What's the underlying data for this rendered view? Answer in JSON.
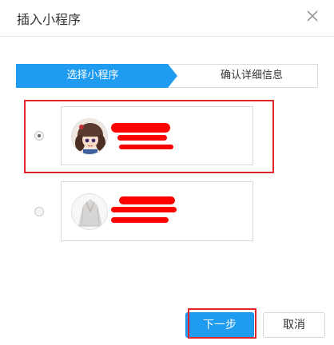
{
  "dialog": {
    "title": "插入小程序",
    "close_icon": "close-icon"
  },
  "steps": [
    {
      "label": "选择小程序",
      "active": true
    },
    {
      "label": "确认详细信息",
      "active": false
    }
  ],
  "options": [
    {
      "selected": true,
      "avatar_icon": "anime-girl-avatar"
    },
    {
      "selected": false,
      "avatar_icon": "grey-cloak-avatar"
    }
  ],
  "footer": {
    "next_label": "下一步",
    "cancel_label": "取消"
  },
  "colors": {
    "accent": "#1f9bf0",
    "highlight": "#e0242b",
    "redaction": "#ff0000"
  }
}
